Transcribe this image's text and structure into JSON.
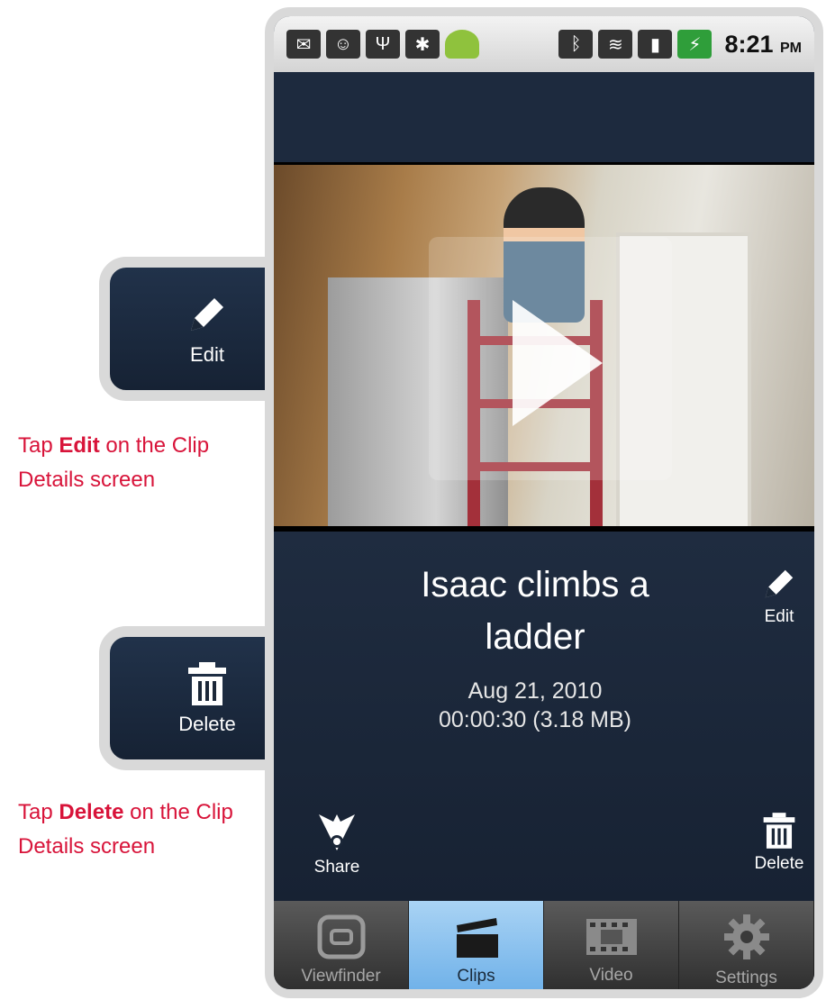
{
  "callouts": {
    "edit": {
      "label": "Edit"
    },
    "delete": {
      "label": "Delete"
    }
  },
  "captions": {
    "edit": {
      "prefix": "Tap ",
      "bold": "Edit",
      "suffix": " on the Clip Details screen"
    },
    "delete": {
      "prefix": "Tap ",
      "bold": "Delete",
      "suffix": " on the Clip Details screen"
    }
  },
  "status_bar": {
    "time": "8:21",
    "ampm": "PM",
    "icons": [
      "gmail-icon",
      "sms-icon",
      "usb-icon",
      "debug-icon",
      "android-icon",
      "bluetooth-icon",
      "wifi-icon",
      "signal-icon",
      "battery-icon"
    ]
  },
  "clip": {
    "title": "Isaac climbs a ladder",
    "date": "Aug 21, 2010",
    "meta": "00:00:30 (3.18 MB)"
  },
  "actions": {
    "edit": "Edit",
    "share": "Share",
    "delete": "Delete"
  },
  "tabs": [
    {
      "label": "Viewfinder",
      "active": false
    },
    {
      "label": "Clips",
      "active": true
    },
    {
      "label": "Video",
      "active": false
    },
    {
      "label": "Settings",
      "active": false
    }
  ],
  "colors": {
    "caption": "#d8143a",
    "active_tab": "#8cc3ee",
    "panel": "#1d2a3e"
  }
}
